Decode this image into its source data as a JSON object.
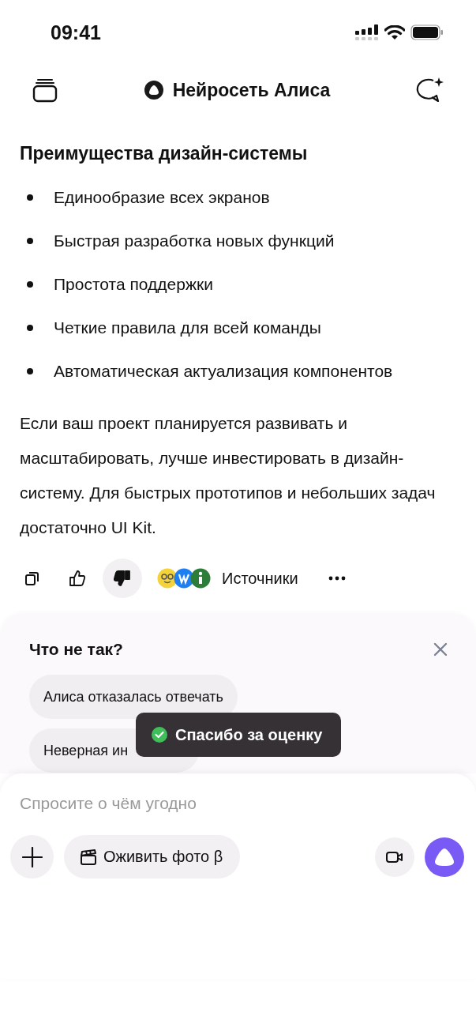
{
  "status_bar": {
    "time": "09:41"
  },
  "header": {
    "title": "Нейросеть Алиса"
  },
  "answer": {
    "heading": "Преимущества дизайн-системы",
    "bullets": [
      "Единообразие всех экранов",
      "Быстрая разработка новых функций",
      "Простота поддержки",
      "Четкие правила для всей команды",
      "Автоматическая актуализация компонентов"
    ],
    "paragraph": "Если ваш проект планируется развивать и масштабировать, лучше инвестировать в дизайн-систему. Для быстрых прототипов и небольших задач достаточно UI Kit."
  },
  "actions": {
    "thumbs_up": {
      "selected": false
    },
    "thumbs_down": {
      "selected": true
    },
    "sources_label": "Источники"
  },
  "feedback": {
    "title": "Что не так?",
    "options": [
      "Алиса отказалась отвечать",
      "Неверная ин"
    ]
  },
  "toast": {
    "text": "Спасибо за оценку"
  },
  "composer": {
    "placeholder": "Спросите о чём угодно",
    "chip": "Оживить фото β"
  }
}
